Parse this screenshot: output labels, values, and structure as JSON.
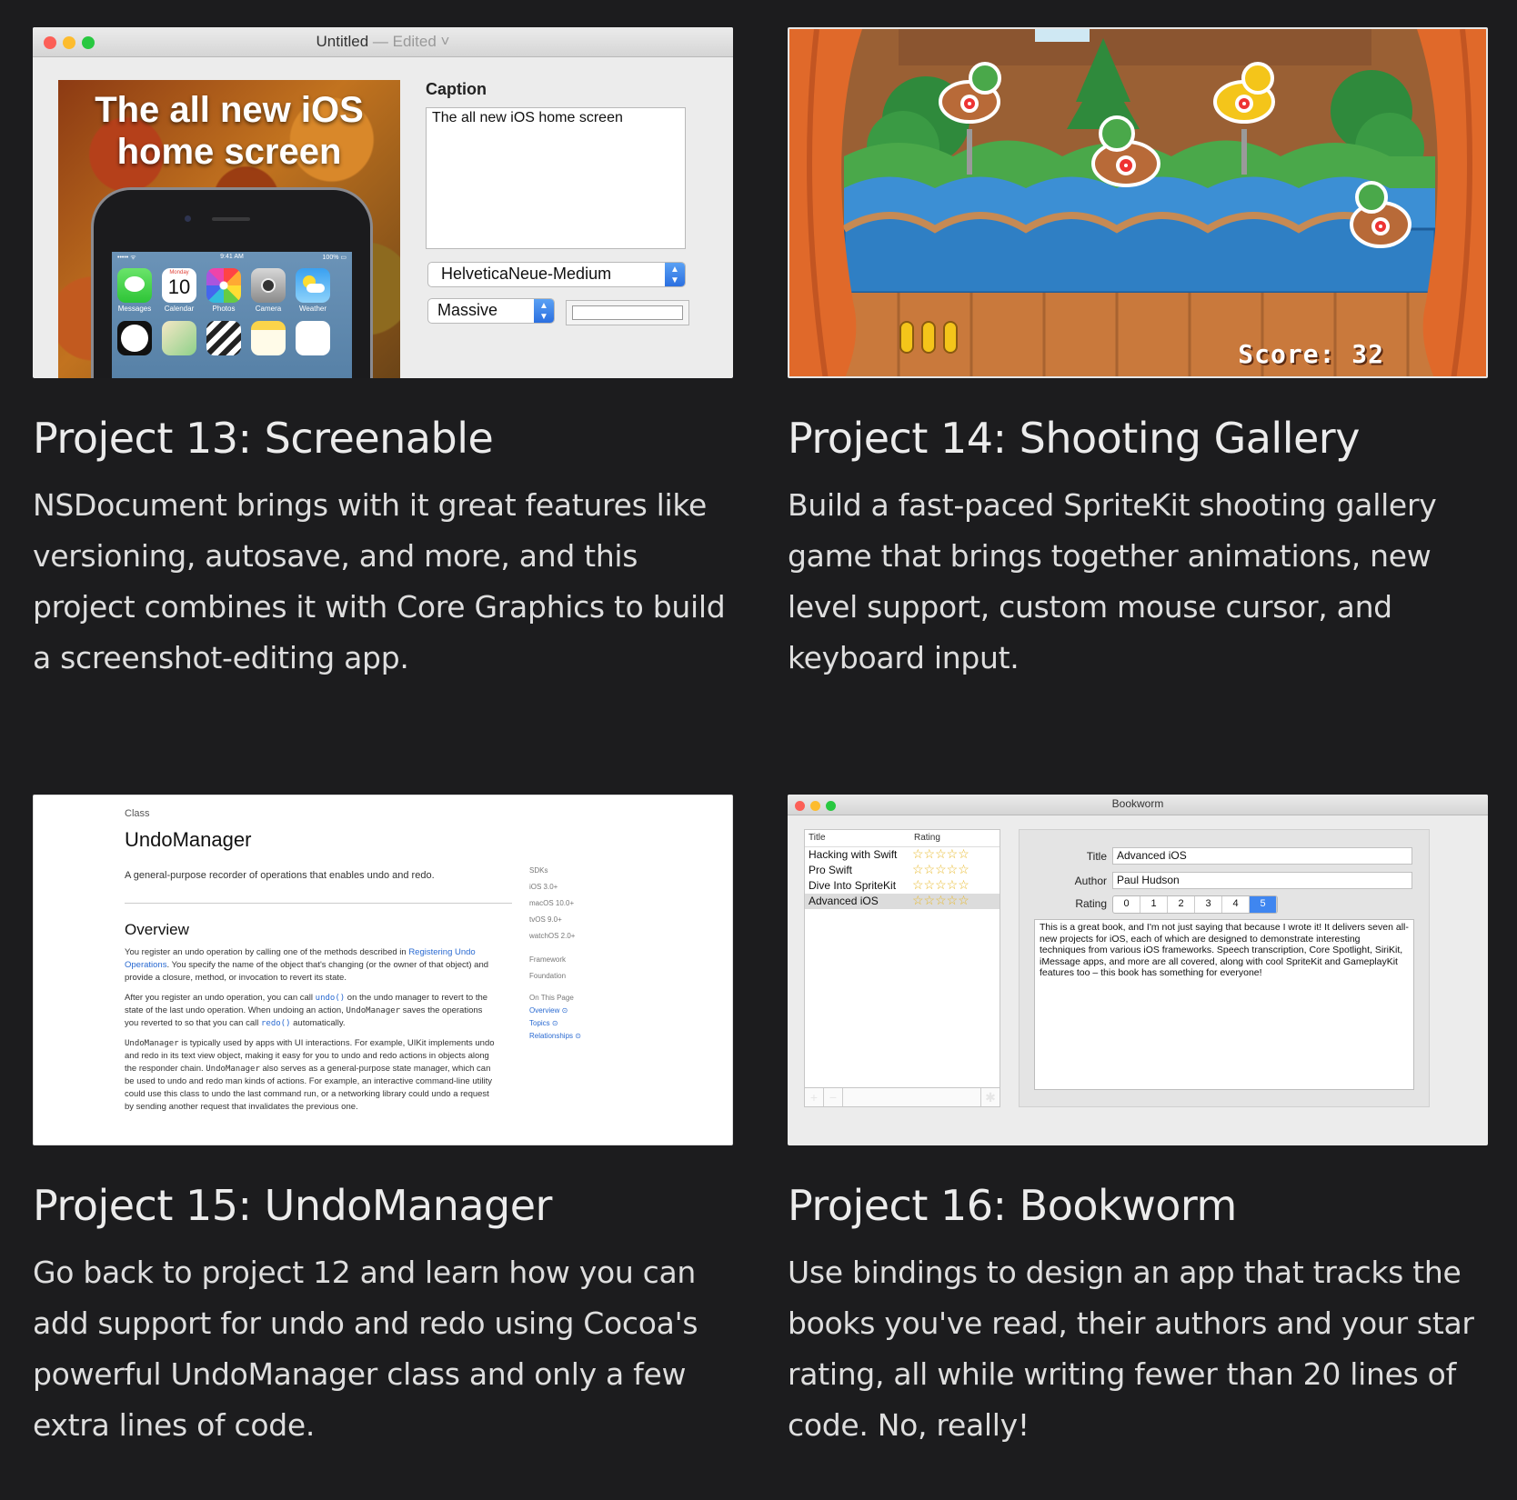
{
  "projects": [
    {
      "title": "Project 13: Screenable",
      "description": "NSDocument brings with it great features like versioning, autosave, and more, and this project combines it with Core Graphics to build a screenshot-editing app.",
      "screenshot": {
        "window_title": "Untitled",
        "window_subtitle": "— Edited ˅",
        "preview_text": "The all new iOS home screen",
        "caption_label": "Caption",
        "caption_value": "The all new iOS home screen",
        "font_value": "HelveticaNeue-Medium",
        "size_value": "Massive",
        "phone": {
          "time": "9:41 AM",
          "carrier": "••••• ᯤ",
          "battery": "100% ▭",
          "calendar_day": "Monday",
          "calendar_date": "10",
          "apps": [
            "Messages",
            "Calendar",
            "Photos",
            "Camera",
            "Weather"
          ]
        }
      }
    },
    {
      "title": "Project 14: Shooting Gallery",
      "description": "Build a fast-paced SpriteKit shooting gallery game that brings together animations, new level support, custom mouse cursor, and keyboard input.",
      "screenshot": {
        "score_text": "Score: 32",
        "bullets": 3
      }
    },
    {
      "title": "Project 15: UndoManager",
      "description": "Go back to project 12 and learn how you can add support for undo and redo using Cocoa's powerful UndoManager class and only a few extra lines of code.",
      "screenshot": {
        "kind": "Class",
        "heading": "UndoManager",
        "abstract": "A general-purpose recorder of operations that enables undo and redo.",
        "overview_heading": "Overview",
        "p1_a": "You register an undo operation by calling one of the methods described in ",
        "p1_link": "Registering Undo Operations",
        "p1_b": ". You specify the name of the object that's changing (or the owner of that object) and provide a closure, method, or invocation to revert its state.",
        "p2_a": "After you register an undo operation, you can call ",
        "p2_code1": "undo()",
        "p2_b": " on the undo manager to revert to the state of the last undo operation. When undoing an action, ",
        "p2_code2": "UndoManager",
        "p2_c": " saves the operations you reverted to so that you can call ",
        "p2_code3": "redo()",
        "p2_d": " automatically.",
        "p3_code": "UndoManager",
        "p3_a": " is typically used by apps with UI interactions. For example, UIKit implements undo and redo in its text view object, making it easy for you to undo and redo actions in objects along the responder chain. ",
        "p3_code2": "UndoManager",
        "p3_b": " also serves as a general-purpose state manager, which can be used to undo and redo man kinds of actions. For example, an interactive command-line utility could use this class to undo the last command run, or a networking library could undo a request by sending another request that invalidates the previous one.",
        "sidebar": {
          "sdks_label": "SDKs",
          "sdks": [
            "iOS 3.0+",
            "macOS 10.0+",
            "tvOS 9.0+",
            "watchOS 2.0+"
          ],
          "framework_label": "Framework",
          "framework": "Foundation",
          "on_page_label": "On This Page",
          "on_page": [
            "Overview ⊙",
            "Topics ⊙",
            "Relationships ⊙"
          ]
        }
      }
    },
    {
      "title": "Project 16: Bookworm",
      "description": "Use bindings to design an app that tracks the books you've read, their authors and your star rating, all while writing fewer than 20 lines of code. No, really!",
      "screenshot": {
        "window_title": "Bookworm",
        "col_title": "Title",
        "col_rating": "Rating",
        "books": [
          {
            "title": "Hacking with Swift",
            "stars": "☆☆☆☆☆"
          },
          {
            "title": "Pro Swift",
            "stars": "☆☆☆☆☆"
          },
          {
            "title": "Dive Into SpriteKit",
            "stars": "☆☆☆☆☆"
          },
          {
            "title": "Advanced iOS",
            "stars": "☆☆☆☆☆"
          }
        ],
        "add_label": "+",
        "remove_label": "−",
        "gear_label": "✱",
        "title_label": "Title",
        "title_value": "Advanced iOS",
        "author_label": "Author",
        "author_value": "Paul Hudson",
        "rating_label": "Rating",
        "rating_options": [
          "0",
          "1",
          "2",
          "3",
          "4",
          "5"
        ],
        "rating_selected": "5",
        "review": "This is a great book, and I'm not just saying that because I wrote it! It delivers seven all-new projects for iOS, each of which are designed to demonstrate interesting techniques from various iOS frameworks. Speech transcription, Core Spotlight, SiriKit, iMessage apps, and more are all covered, along with cool SpriteKit and GameplayKit features too – this book has something for everyone!"
      }
    }
  ]
}
